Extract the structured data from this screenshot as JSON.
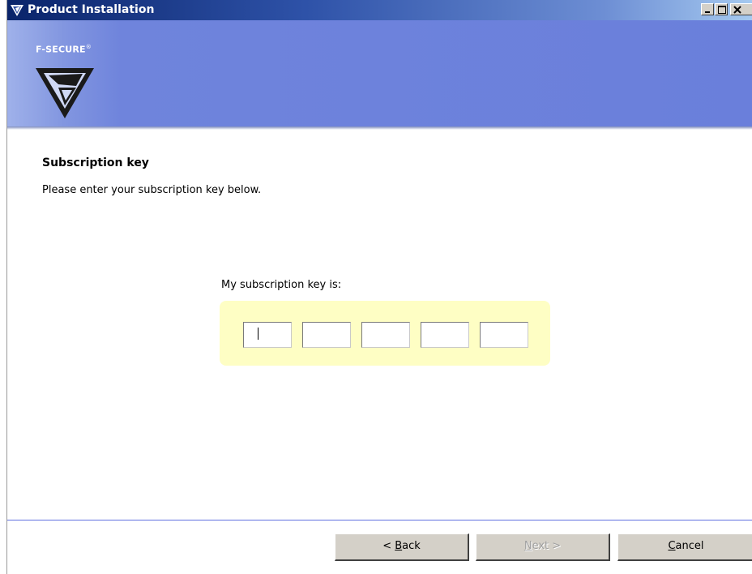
{
  "window": {
    "title": "Product Installation"
  },
  "banner": {
    "brand": "F-SECURE",
    "brand_mark": "®"
  },
  "content": {
    "heading": "Subscription key",
    "instruction": "Please enter your subscription key below.",
    "key_label": "My subscription key is:",
    "key_fields": [
      {
        "value": ""
      },
      {
        "value": ""
      },
      {
        "value": ""
      },
      {
        "value": ""
      },
      {
        "value": ""
      }
    ]
  },
  "buttons": {
    "back": {
      "prefix": "< ",
      "accel": "B",
      "rest": "ack"
    },
    "next": {
      "accel": "N",
      "rest": "ext >"
    },
    "cancel": {
      "accel": "C",
      "rest": "ancel"
    }
  },
  "colors": {
    "banner": "#6a7fdb",
    "key_panel": "#fefec4",
    "divider": "#6070e0"
  },
  "icons": {
    "app": "f-secure-logo-icon",
    "minimize": "minimize-icon",
    "maximize": "maximize-icon",
    "close": "close-icon"
  }
}
